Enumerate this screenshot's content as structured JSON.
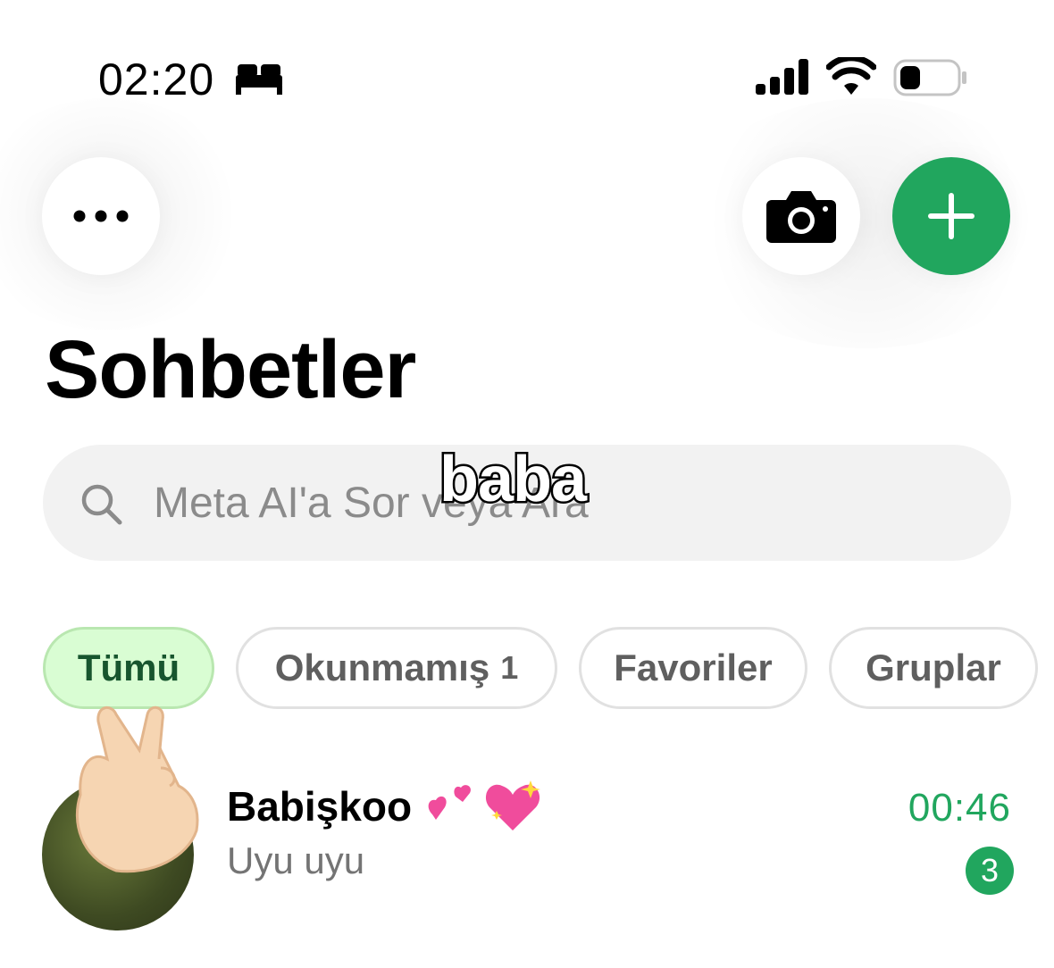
{
  "status_bar": {
    "time": "02:20",
    "icons": [
      "bed-icon",
      "signal-icon",
      "wifi-icon",
      "battery-icon"
    ]
  },
  "header": {
    "more_icon": "ellipsis-icon",
    "camera_icon": "camera-icon",
    "new_chat_icon": "plus-icon",
    "title": "Sohbetler"
  },
  "search": {
    "placeholder": "Meta AI'a Sor veya Ara"
  },
  "sticker": {
    "text": "baba"
  },
  "filters": [
    {
      "label": "Tümü",
      "count": "",
      "selected": true
    },
    {
      "label": "Okunmamış",
      "count": "1",
      "selected": false
    },
    {
      "label": "Favoriler",
      "count": "",
      "selected": false
    },
    {
      "label": "Gruplar",
      "count": "",
      "selected": false
    }
  ],
  "chats": [
    {
      "name": "Babişkoo",
      "emojis": [
        "two-hearts-icon",
        "sparkling-heart-icon"
      ],
      "last_message": "Uyu uyu",
      "time": "00:46",
      "unread": "3"
    }
  ],
  "colors": {
    "accent": "#21a65e",
    "chip_selected_bg": "#d9fdd3",
    "chip_selected_text": "#17552e"
  }
}
